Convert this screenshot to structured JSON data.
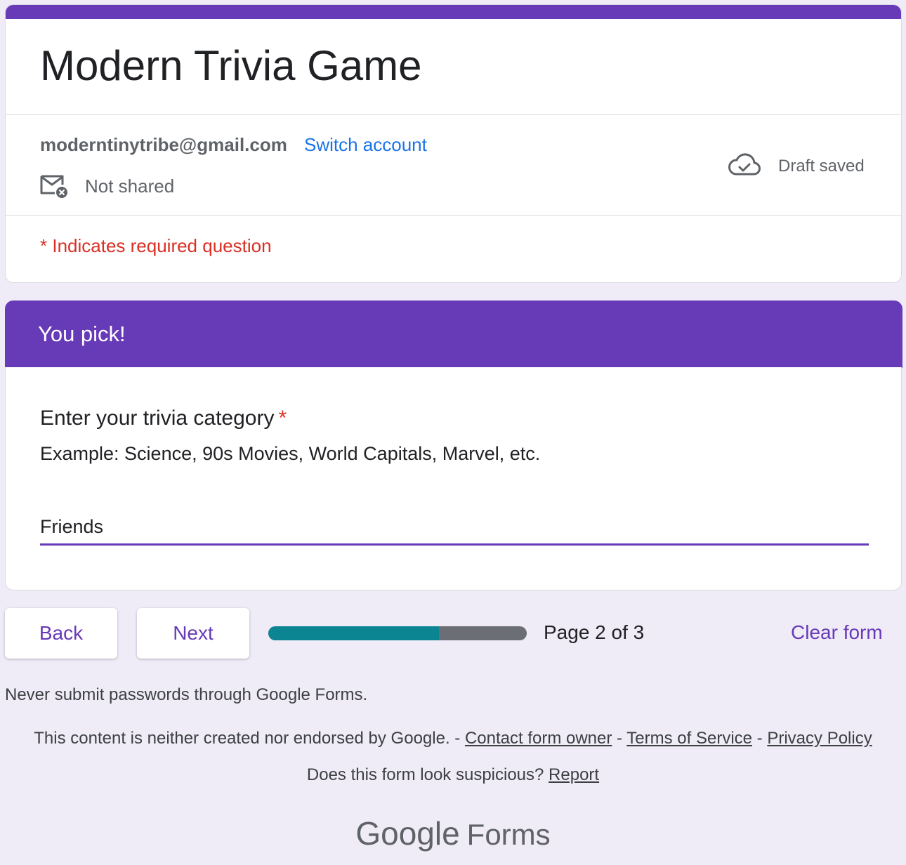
{
  "form": {
    "title": "Modern Trivia Game",
    "account_email": "moderntinytribe@gmail.com",
    "switch_account": "Switch account",
    "sharing_status": "Not shared",
    "save_status": "Draft saved",
    "required_note": "* Indicates required question"
  },
  "section": {
    "title": "You pick!"
  },
  "question": {
    "title": "Enter your trivia category",
    "required_marker": "*",
    "description": "Example: Science, 90s Movies, World Capitals, Marvel, etc.",
    "answer_value": "Friends"
  },
  "navigation": {
    "back_label": "Back",
    "next_label": "Next",
    "progress_fraction": 0.66,
    "page_indicator": "Page 2 of 3",
    "clear_label": "Clear form"
  },
  "footer": {
    "password_warning": "Never submit passwords through Google Forms.",
    "disclaimer_prefix": "This content is neither created nor endorsed by Google. -",
    "contact_owner": "Contact form owner",
    "separator": "-",
    "terms": "Terms of Service",
    "privacy": "Privacy Policy",
    "suspicious_prefix": "Does this form look suspicious?",
    "report": "Report",
    "brand_google": "Google",
    "brand_forms": "Forms"
  },
  "icons": {
    "not_shared": "mail-x-icon",
    "draft_saved": "cloud-check-icon"
  },
  "colors": {
    "accent": "#673ab7",
    "background": "#efebf7",
    "required": "#d93025",
    "link": "#1a73e8",
    "progress_fill": "#0b8591",
    "progress_track": "#6b6e74"
  }
}
